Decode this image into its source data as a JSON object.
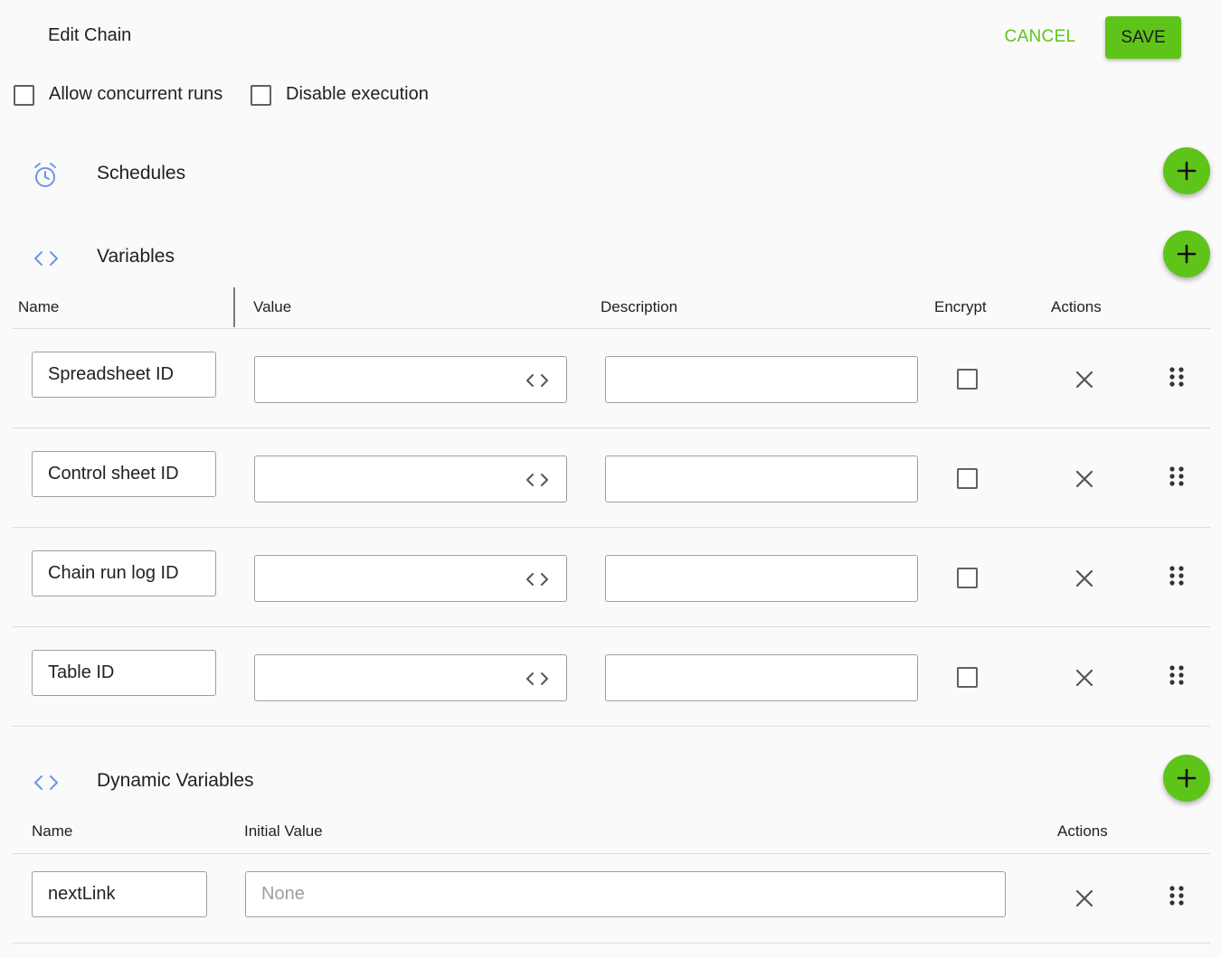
{
  "header": {
    "title": "Edit Chain",
    "cancel_label": "CANCEL",
    "save_label": "SAVE"
  },
  "options": {
    "allow_concurrent": {
      "label": "Allow concurrent runs",
      "checked": false
    },
    "disable_execution": {
      "label": "Disable execution",
      "checked": false
    }
  },
  "schedules": {
    "title": "Schedules",
    "icon": "alarm-clock-icon"
  },
  "variables": {
    "title": "Variables",
    "icon": "code-brackets-icon",
    "columns": {
      "name": "Name",
      "value": "Value",
      "description": "Description",
      "encrypt": "Encrypt",
      "actions": "Actions"
    },
    "rows": [
      {
        "name": "Spreadsheet ID",
        "value": "",
        "description": "",
        "encrypt": false
      },
      {
        "name": "Control sheet ID",
        "value": "",
        "description": "",
        "encrypt": false
      },
      {
        "name": "Chain run log ID",
        "value": "",
        "description": "",
        "encrypt": false
      },
      {
        "name": "Table ID",
        "value": "",
        "description": "",
        "encrypt": false
      }
    ]
  },
  "dynamic_variables": {
    "title": "Dynamic Variables",
    "icon": "code-brackets-icon",
    "columns": {
      "name": "Name",
      "initial_value": "Initial Value",
      "actions": "Actions"
    },
    "rows": [
      {
        "name": "nextLink",
        "initial_value": "",
        "initial_value_placeholder": "None"
      }
    ]
  },
  "colors": {
    "accent": "#5fc41a",
    "icon_blue": "#6a96e8"
  }
}
